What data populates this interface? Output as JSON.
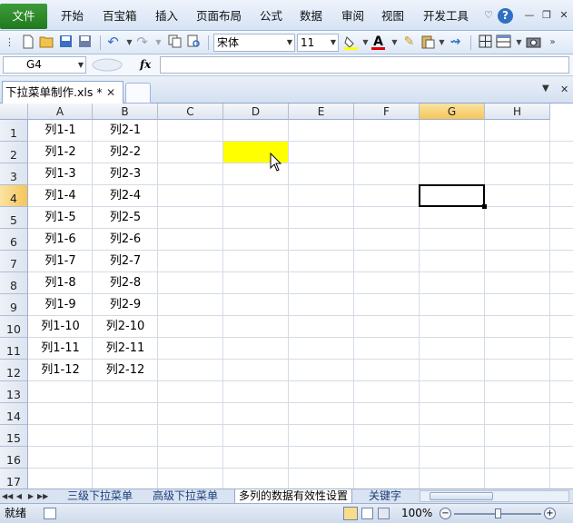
{
  "menubar": {
    "items": [
      "文件",
      "开始",
      "百宝箱",
      "插入",
      "页面布局",
      "公式",
      "数据",
      "审阅",
      "视图",
      "开发工具"
    ],
    "help_label": "?"
  },
  "toolbar": {
    "font_name": "宋体",
    "font_size": "11",
    "font_color_glyph": "A"
  },
  "formula_bar": {
    "name_box": "G4",
    "fx_label": "fx",
    "formula": ""
  },
  "document": {
    "tab_title": "下拉菜单制作.xls *",
    "close_glyph": "✕"
  },
  "grid": {
    "columns": [
      "A",
      "B",
      "C",
      "D",
      "E",
      "F",
      "G",
      "H"
    ],
    "selected_column": "G",
    "rows": [
      "1",
      "2",
      "3",
      "4",
      "5",
      "6",
      "7",
      "8",
      "9",
      "10",
      "11",
      "12",
      "13",
      "14",
      "15",
      "16",
      "17"
    ],
    "selected_row": "4",
    "column_a": [
      "列1-1",
      "列1-2",
      "列1-3",
      "列1-4",
      "列1-5",
      "列1-6",
      "列1-7",
      "列1-8",
      "列1-9",
      "列1-10",
      "列1-11",
      "列1-12"
    ],
    "column_b": [
      "列2-1",
      "列2-2",
      "列2-3",
      "列2-4",
      "列2-5",
      "列2-6",
      "列2-7",
      "列2-8",
      "列2-9",
      "列2-10",
      "列2-11",
      "列2-12"
    ],
    "highlight_cell": "D2",
    "highlight_color": "#FFFF00",
    "active_cell": "G4"
  },
  "sheets": {
    "tabs": [
      "三级下拉菜单",
      "高级下拉菜单",
      "多列的数据有效性设置",
      "关键字"
    ],
    "active_index": 2
  },
  "status": {
    "text": "就绪",
    "zoom": "100%"
  },
  "colors": {
    "file_menu": "#1F7A1D",
    "selected_header": "#F4C65B",
    "grid_line": "#D4DBE6"
  }
}
